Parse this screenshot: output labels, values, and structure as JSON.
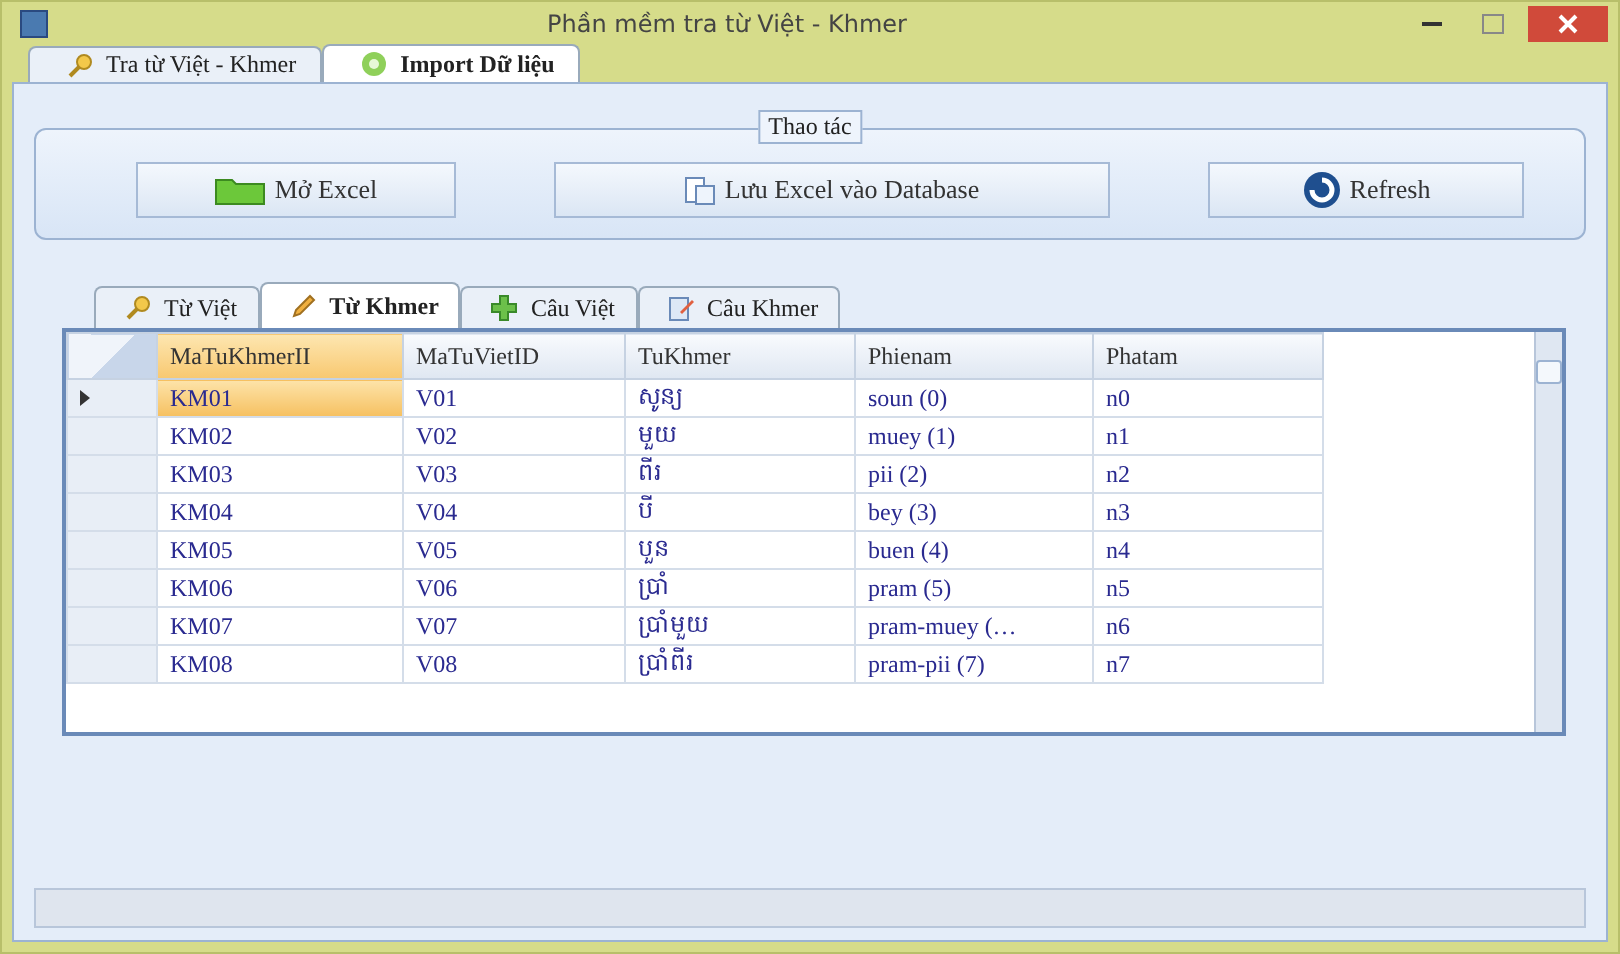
{
  "window": {
    "title": "Phần mềm tra từ Việt - Khmer"
  },
  "tabs": [
    {
      "label": "Tra từ Việt - Khmer",
      "selected": false
    },
    {
      "label": "Import Dữ liệu",
      "selected": true
    }
  ],
  "group": {
    "title": "Thao tác",
    "buttons": [
      {
        "label": "Mở Excel"
      },
      {
        "label": "Lưu Excel vào Database"
      },
      {
        "label": "Refresh"
      }
    ]
  },
  "subtabs": [
    {
      "label": "Từ Việt",
      "selected": false
    },
    {
      "label": "Từ Khmer",
      "selected": true
    },
    {
      "label": "Câu Việt",
      "selected": false
    },
    {
      "label": "Câu Khmer",
      "selected": false
    }
  ],
  "table": {
    "columns": [
      "MaTuKhmerII",
      "MaTuVietID",
      "TuKhmer",
      "Phienam",
      "Phatam"
    ],
    "rows": [
      {
        "selected": true,
        "cells": [
          "KM01",
          "V01",
          "សូន្យ",
          "soun (0)",
          "n0"
        ]
      },
      {
        "selected": false,
        "cells": [
          "KM02",
          "V02",
          "មួយ",
          "muey (1)",
          "n1"
        ]
      },
      {
        "selected": false,
        "cells": [
          "KM03",
          "V03",
          "ពីរ",
          "pii (2)",
          "n2"
        ]
      },
      {
        "selected": false,
        "cells": [
          "KM04",
          "V04",
          "បី",
          "bey (3)",
          "n3"
        ]
      },
      {
        "selected": false,
        "cells": [
          "KM05",
          "V05",
          "បួន",
          "buen (4)",
          "n4"
        ]
      },
      {
        "selected": false,
        "cells": [
          "KM06",
          "V06",
          "ប្រាំ",
          "pram (5)",
          "n5"
        ]
      },
      {
        "selected": false,
        "cells": [
          "KM07",
          "V07",
          "ប្រាំមួយ",
          "pram-muey (…",
          "n6"
        ]
      },
      {
        "selected": false,
        "cells": [
          "KM08",
          "V08",
          "ប្រាំពីរ",
          "pram-pii (7)",
          "n7"
        ]
      }
    ]
  }
}
